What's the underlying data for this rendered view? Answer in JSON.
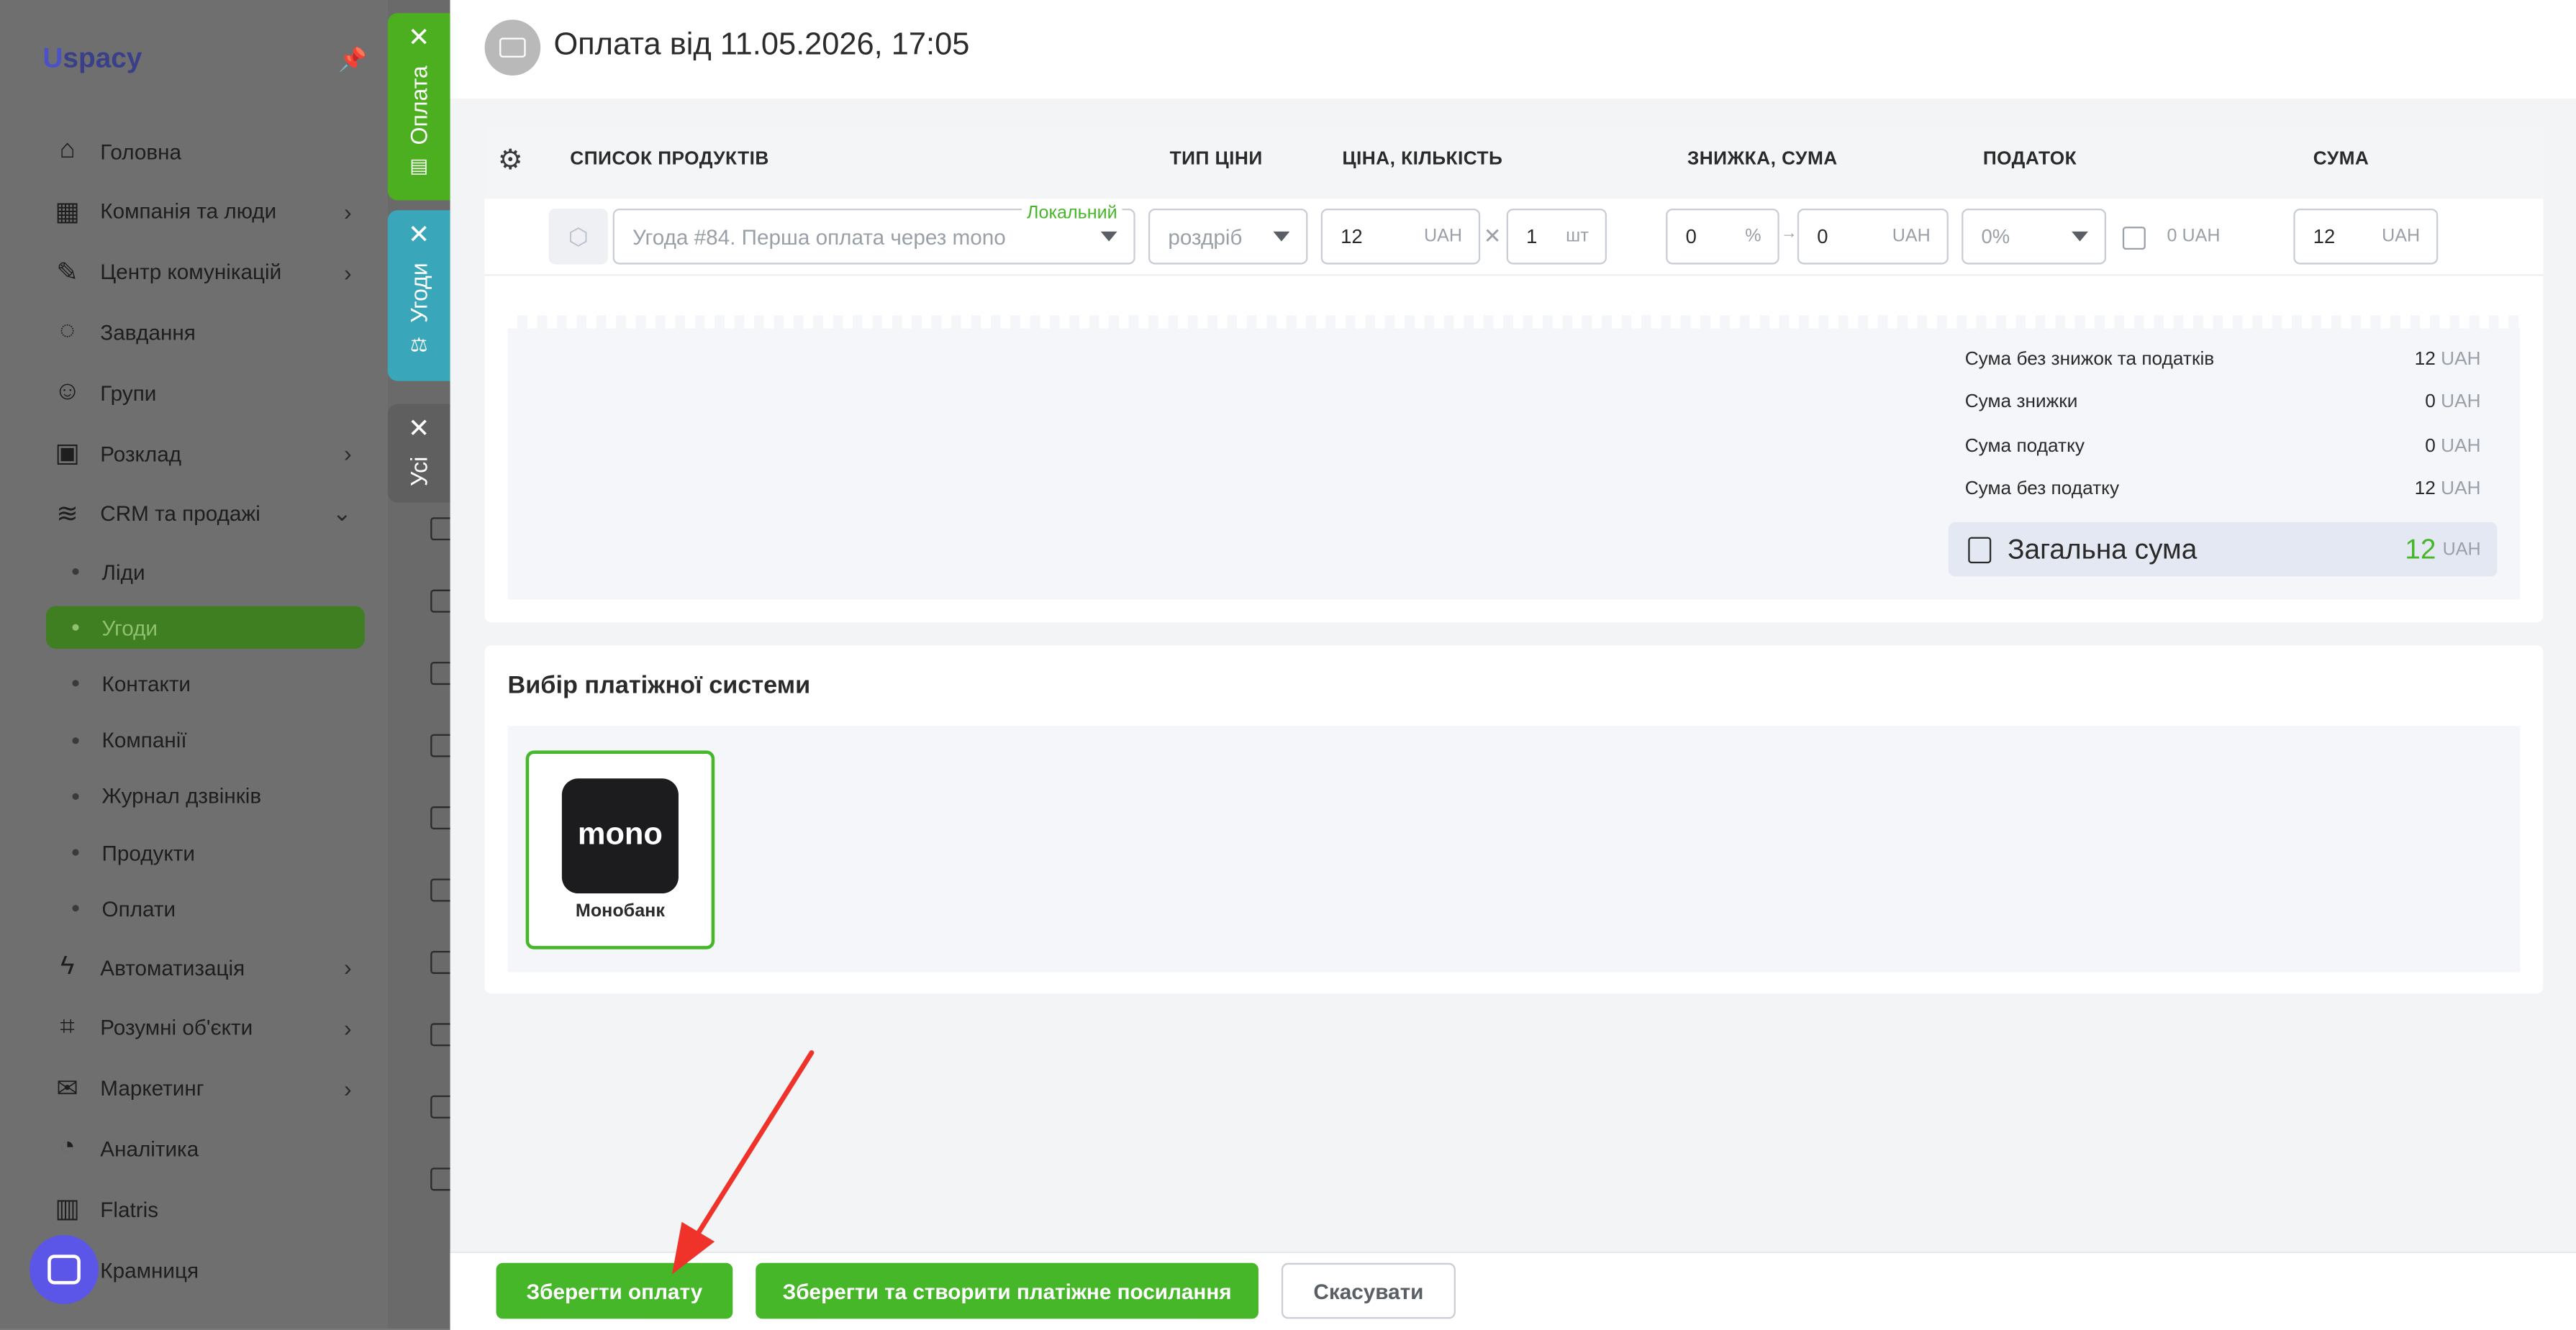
{
  "app": {
    "logo": "spacy",
    "logo_u": "U"
  },
  "sidebar": {
    "items": [
      {
        "label": "Головна",
        "icon": "home-icon",
        "glyph": "⌂",
        "chevron": false
      },
      {
        "label": "Компанія та люди",
        "icon": "company-icon",
        "glyph": "▦",
        "chevron": true
      },
      {
        "label": "Центр комунікацій",
        "icon": "chat-icon",
        "glyph": "✎",
        "chevron": true
      },
      {
        "label": "Завдання",
        "icon": "check-circle-icon",
        "glyph": "◌",
        "chevron": false
      },
      {
        "label": "Групи",
        "icon": "users-icon",
        "glyph": "☺",
        "chevron": false
      },
      {
        "label": "Розклад",
        "icon": "calendar-icon",
        "glyph": "▣",
        "chevron": true
      },
      {
        "label": "CRM та продажі",
        "icon": "database-icon",
        "glyph": "≋",
        "chevron": true
      }
    ],
    "sub_items": [
      "Ліди",
      "Угоди",
      "Контакти",
      "Компанії",
      "Журнал дзвінків",
      "Продукти",
      "Оплати"
    ],
    "active_sub": "Угоди",
    "items_bottom": [
      {
        "label": "Автоматизація",
        "icon": "bolt-icon",
        "glyph": "ϟ",
        "chevron": true
      },
      {
        "label": "Розумні об'єкти",
        "icon": "scan-icon",
        "glyph": "⌗",
        "chevron": true
      },
      {
        "label": "Маркетинг",
        "icon": "megaphone-icon",
        "glyph": "✉",
        "chevron": true
      },
      {
        "label": "Аналітика",
        "icon": "analytics-icon",
        "glyph": "◔",
        "chevron": false
      },
      {
        "label": "Flatris",
        "icon": "flatris-icon",
        "glyph": "▥",
        "chevron": false
      },
      {
        "label": "Крамниця",
        "icon": "shop-icon",
        "glyph": "⌂",
        "chevron": false
      }
    ]
  },
  "vtabs": [
    {
      "label": "Оплата",
      "color": "#4caf1f"
    },
    {
      "label": "Угоди",
      "color": "#3aa6b9"
    },
    {
      "label": "Усі",
      "color": "#5f5f5f"
    }
  ],
  "header": {
    "title": "Оплата від 11.05.2026, 17:05"
  },
  "table": {
    "headers": {
      "products": "СПИСОК ПРОДУКТІВ",
      "price_type": "ТИП ЦІНИ",
      "price_qty": "ЦІНА, КІЛЬКІСТЬ",
      "discount": "ЗНИЖКА, СУМА",
      "tax": "ПОДАТОК",
      "sum": "СУМА"
    },
    "row": {
      "product_placeholder": "Угода #84. Перша оплата через mono",
      "local_badge": "Локальний",
      "price_type": "роздріб",
      "price": "12",
      "price_unit": "UAH",
      "qty": "1",
      "qty_unit": "шт",
      "discount_pct": "0",
      "pct_sign": "%",
      "discount_sum": "0",
      "discount_unit": "UAH",
      "tax": "0%",
      "tax_amount": "0",
      "tax_unit": "UAH",
      "sum": "12",
      "sum_unit": "UAH"
    }
  },
  "summary": {
    "rows": [
      {
        "label": "Сума без знижок та податків",
        "value": "12",
        "unit": "UAH"
      },
      {
        "label": "Сума знижки",
        "value": "0",
        "unit": "UAH"
      },
      {
        "label": "Сума податку",
        "value": "0",
        "unit": "UAH"
      },
      {
        "label": "Сума без податку",
        "value": "12",
        "unit": "UAH"
      }
    ],
    "total_label": "Загальна сума",
    "total_value": "12",
    "total_unit": "UAH"
  },
  "payment": {
    "title": "Вибір платіжної системи",
    "system_logo": "mono",
    "system_name": "Монобанк"
  },
  "footer": {
    "save": "Зберегти оплату",
    "save_link": "Зберегти та створити платіжне посилання",
    "cancel": "Скасувати"
  },
  "colors": {
    "accent": "#47b72a",
    "arrow": "#f0332a"
  }
}
